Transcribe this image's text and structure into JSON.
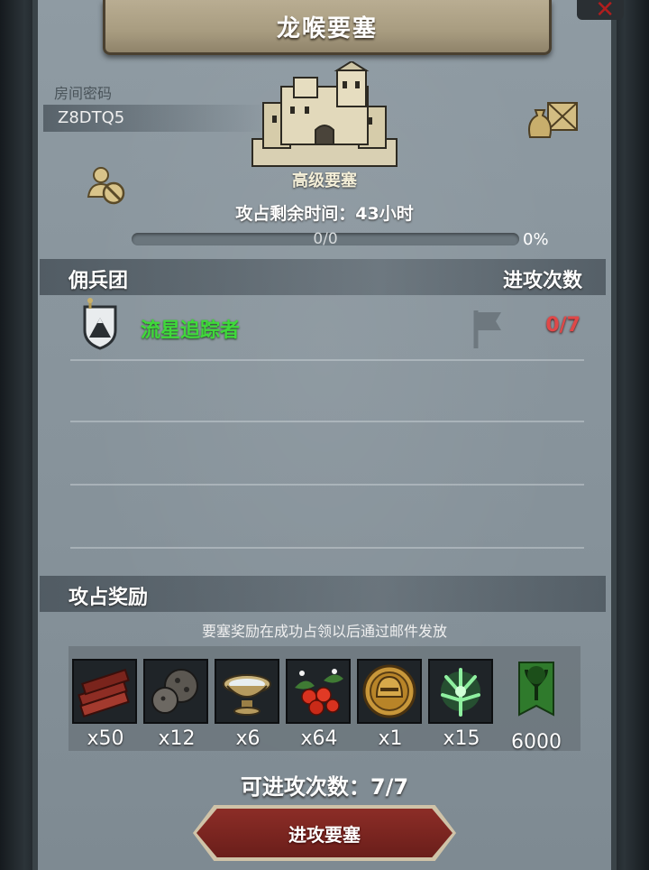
{
  "title": "龙喉要塞",
  "room": {
    "label": "房间密码",
    "code": "Z8DTQ5"
  },
  "fortress": {
    "type": "高级要塞",
    "time_left": "攻占剩余时间：43小时",
    "progress_text": "0/0",
    "progress_percent": "0%",
    "progress_fraction": 0
  },
  "mercenary_section": {
    "label": "佣兵团",
    "attacks_label": "进攻次数",
    "rows": [
      {
        "name": "流星追踪者",
        "attacks": "0/7"
      }
    ]
  },
  "reward_section": {
    "label": "攻占奖励",
    "note": "要塞奖励在成功占领以后通过邮件发放",
    "items": [
      {
        "icon": "wood-planks-icon",
        "count": "x50"
      },
      {
        "icon": "ore-rock-icon",
        "count": "x12"
      },
      {
        "icon": "silver-bowl-icon",
        "count": "x6"
      },
      {
        "icon": "berries-icon",
        "count": "x64"
      },
      {
        "icon": "gold-helmet-coin-icon",
        "count": "x1"
      },
      {
        "icon": "green-tree-spirit-icon",
        "count": "x15"
      },
      {
        "icon": "tree-banner-icon",
        "count": "6000"
      }
    ]
  },
  "attempts": "可进攻次数：7/7",
  "attack_button": "进攻要塞",
  "colors": {
    "merc_name": "#3fd93a",
    "attack_count": "#e04848",
    "button": "#7a2520"
  }
}
